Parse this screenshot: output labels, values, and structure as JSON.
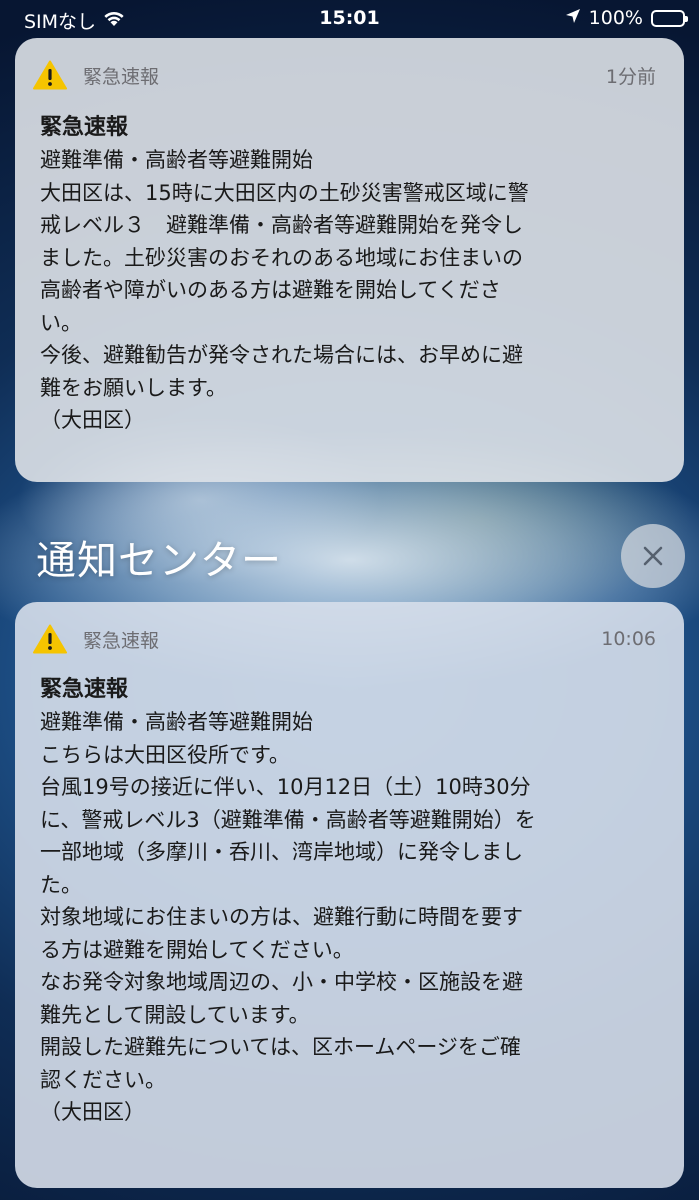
{
  "status_bar": {
    "carrier": "SIMなし",
    "time": "15:01",
    "battery": "100%"
  },
  "notifications": [
    {
      "app": "緊急速報",
      "when": "1分前",
      "title": "緊急速報",
      "body": "避難準備・高齢者等避難開始\n大田区は、15時に大田区内の土砂災害警戒区域に警\n戒レベル３　避難準備・高齢者等避難開始を発令し\nました。土砂災害のおそれのある地域にお住まいの\n高齢者や障がいのある方は避難を開始してくださ\nい。\n今後、避難勧告が発令された場合には、お早めに避\n難をお願いします。\n（大田区）"
    },
    {
      "app": "緊急速報",
      "when": "10:06",
      "title": "緊急速報",
      "body": "避難準備・高齢者等避難開始\nこちらは大田区役所です。\n台風19号の接近に伴い、10月12日（土）10時30分\nに、警戒レベル3（避難準備・高齢者等避難開始）を\n一部地域（多摩川・呑川、湾岸地域）に発令しまし\nた。\n対象地域にお住まいの方は、避難行動に時間を要す\nる方は避難を開始してください。\nなお発令対象地域周辺の、小・中学校・区施設を避\n難先として開設しています。\n開設した避難先については、区ホームページをご確\n認ください。\n（大田区）"
    }
  ],
  "notification_center": {
    "label": "通知センター",
    "close_icon": "close-icon"
  },
  "colors": {
    "warning": "#f5c400",
    "battery": "#4cd964"
  }
}
